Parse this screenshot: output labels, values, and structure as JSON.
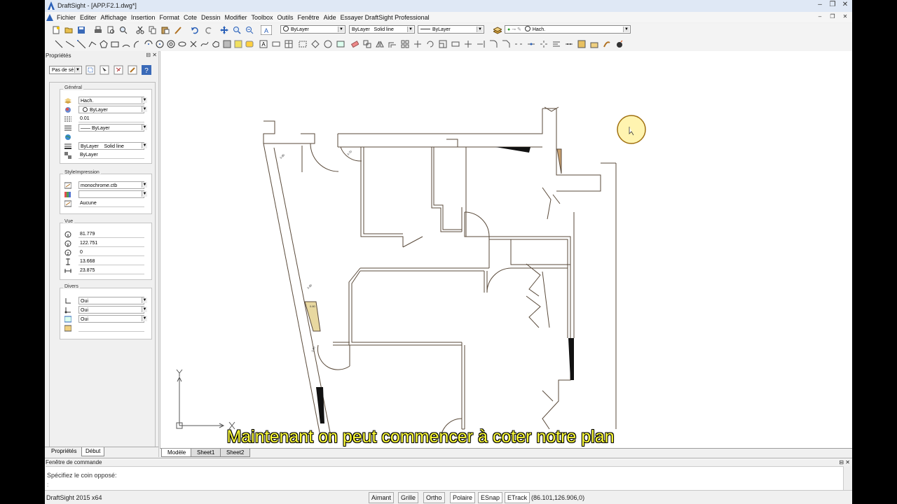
{
  "window": {
    "app_name": "DraftSight",
    "document": "[APP.F2.1.dwg*]",
    "title": "DraftSight - [APP.F2.1.dwg*]"
  },
  "menu": {
    "items": [
      "Fichier",
      "Editer",
      "Affichage",
      "Insertion",
      "Format",
      "Cote",
      "Dessin",
      "Modifier",
      "Toolbox",
      "Outils",
      "Fenêtre",
      "Aide",
      "Essayer DraftSight Professional"
    ]
  },
  "toolbar": {
    "color_combo": "ByLayer",
    "linetype_combo_a": "ByLayer",
    "linetype_combo_b": "Solid line",
    "lineweight_combo": "ByLayer",
    "layer_combo": "Hach."
  },
  "properties": {
    "title": "Propriétés",
    "selection": "Pas de sé",
    "general": {
      "title": "Général",
      "layer": "Hach.",
      "color": "ByLayer",
      "scale": "0.01",
      "linetype": "ByLayer",
      "lineweight_a": "ByLayer",
      "lineweight_b": "Solid line",
      "transparency": "ByLayer"
    },
    "print_style": {
      "title": "StyleImpression",
      "style": "monochrome.ctb",
      "table": "",
      "value": "Aucune"
    },
    "view": {
      "title": "Vue",
      "center_x": "81.779",
      "center_y": "122.751",
      "center_z": "0",
      "height": "13.668",
      "width": "23.875"
    },
    "misc": {
      "title": "Divers",
      "ucs_icon": "Oui",
      "ucs_origin": "Oui",
      "ucs_per_viewport": "Oui",
      "ucs_name": ""
    },
    "tabs": [
      "Propriétés",
      "Début"
    ]
  },
  "sheets": [
    "Modèle",
    "Sheet1",
    "Sheet2"
  ],
  "command": {
    "title": "Fenêtre de commande",
    "line": "Spécifiez le coin opposé:",
    "prompt": ":"
  },
  "status": {
    "version": "DraftSight 2015 x64",
    "toggles": [
      "Aimant",
      "Grille",
      "Ortho",
      "Polaire",
      "ESnap",
      "ETrack"
    ],
    "coordinates": "(86.101,126.906,0)"
  },
  "subtitle": "Maintenant on peut commencer à coter notre plan",
  "colors": {
    "canvas": "#ffffff",
    "wall_line": "#5a4a3a",
    "subtitle": "#ffff3a",
    "cursor_fill": "#fff4b0"
  }
}
